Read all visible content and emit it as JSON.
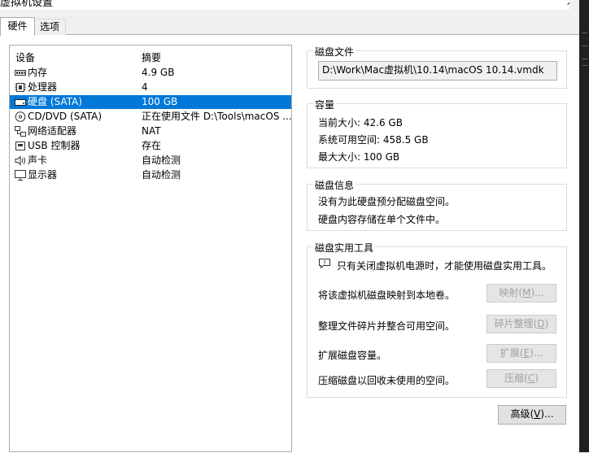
{
  "window": {
    "title": "虚拟机设置"
  },
  "tabs": [
    {
      "label": "硬件"
    },
    {
      "label": "选项"
    }
  ],
  "device_list": {
    "headers": {
      "device": "设备",
      "summary": "摘要"
    },
    "items": [
      {
        "name": "内存",
        "summary": "4.9 GB",
        "icon": "memory-icon"
      },
      {
        "name": "处理器",
        "summary": "4",
        "icon": "cpu-icon"
      },
      {
        "name": "硬盘 (SATA)",
        "summary": "100 GB",
        "icon": "hard-disk-icon",
        "selected": true
      },
      {
        "name": "CD/DVD (SATA)",
        "summary": "正在使用文件 D:\\Tools\\macOS ...",
        "icon": "cd-dvd-icon"
      },
      {
        "name": "网络适配器",
        "summary": "NAT",
        "icon": "network-icon"
      },
      {
        "name": "USB 控制器",
        "summary": "存在",
        "icon": "usb-icon"
      },
      {
        "name": "声卡",
        "summary": "自动检测",
        "icon": "speaker-icon"
      },
      {
        "name": "显示器",
        "summary": "自动检测",
        "icon": "monitor-icon"
      }
    ]
  },
  "disk_file": {
    "title": "磁盘文件",
    "path": "D:\\Work\\Mac虚拟机\\10.14\\macOS 10.14.vmdk"
  },
  "capacity": {
    "title": "容量",
    "current_size": "当前大小: 42.6 GB",
    "system_free": "系统可用空间: 458.5 GB",
    "max_size": "最大大小: 100 GB"
  },
  "disk_info": {
    "title": "磁盘信息",
    "line1": "没有为此硬盘预分配磁盘空间。",
    "line2": "硬盘内容存储在单个文件中。"
  },
  "disk_utilities": {
    "title": "磁盘实用工具",
    "note": "只有关闭虚拟机电源时，才能使用磁盘实用工具。",
    "rows": [
      {
        "desc": "将该虚拟机磁盘映射到本地卷。",
        "button": "映射",
        "key": "M",
        "suffix": "..."
      },
      {
        "desc": "整理文件碎片并整合可用空间。",
        "button": "碎片整理",
        "key": "D",
        "suffix": ""
      },
      {
        "desc": "扩展磁盘容量。",
        "button": "扩展",
        "key": "E",
        "suffix": "..."
      },
      {
        "desc": "压缩磁盘以回收未使用的空间。",
        "button": "压缩",
        "key": "C",
        "suffix": ""
      }
    ]
  },
  "advanced_button": {
    "label": "高级",
    "key": "V",
    "suffix": "..."
  },
  "colors": {
    "selection": "#0078d7",
    "disabled_text": "#a0a0a0"
  }
}
